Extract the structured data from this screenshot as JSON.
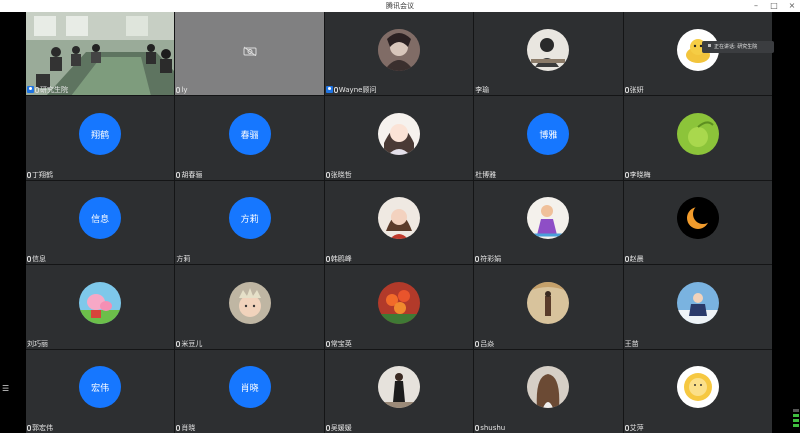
{
  "window": {
    "title": "腾讯会议"
  },
  "toast": {
    "text": "正在讲话: 研究生院"
  },
  "participants": [
    {
      "name": "研究生院",
      "host": true
    },
    {
      "name": "ly"
    },
    {
      "name": "Wayne顾问",
      "host": true
    },
    {
      "name": "李瑜"
    },
    {
      "name": "张妍"
    },
    {
      "name": "丁翔鹤",
      "avatar_text": "翔鹤"
    },
    {
      "name": "胡春骊",
      "avatar_text": "春骊"
    },
    {
      "name": "张晓哲"
    },
    {
      "name": "杜博雅",
      "avatar_text": "博雅"
    },
    {
      "name": "李晓梅"
    },
    {
      "name": "信息",
      "avatar_text": "信息"
    },
    {
      "name": "方莉",
      "avatar_text": "方莉"
    },
    {
      "name": "韩鸥峰"
    },
    {
      "name": "符彩娟"
    },
    {
      "name": "赵晨"
    },
    {
      "name": "刘巧丽"
    },
    {
      "name": "米豆儿"
    },
    {
      "name": "常宝英"
    },
    {
      "name": "吕焱"
    },
    {
      "name": "王苗"
    },
    {
      "name": "郭宏伟",
      "avatar_text": "宏伟"
    },
    {
      "name": "肖晓",
      "avatar_text": "肖晓"
    },
    {
      "name": "吴媛媛"
    },
    {
      "name": "shushu"
    },
    {
      "name": "艾萍"
    }
  ],
  "colors": {
    "tile_bg": "#2d2f31",
    "avatar_blue": "#1677ff",
    "host_blue": "#1f74e3"
  }
}
